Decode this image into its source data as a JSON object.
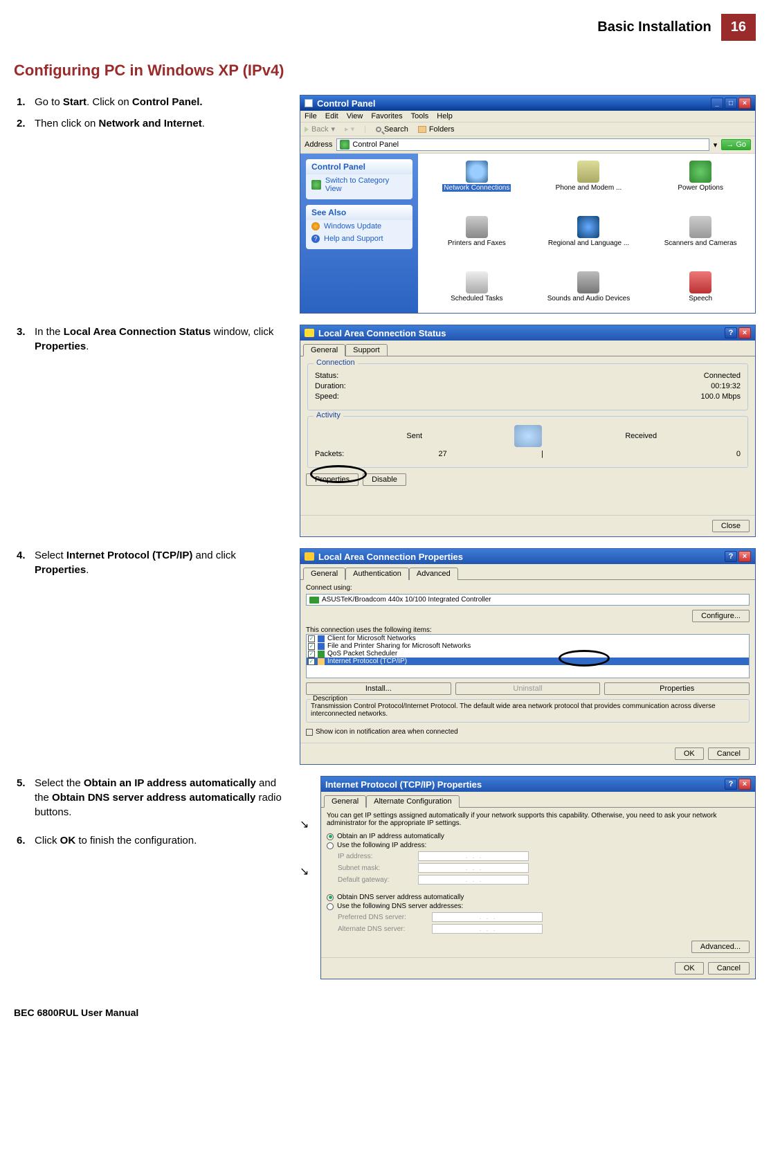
{
  "header": {
    "title": "Basic Installation",
    "page_num": "16"
  },
  "section_title": "Configuring PC in Windows XP (IPv4)",
  "steps": {
    "s1": {
      "num": "1.",
      "pre": "Go to ",
      "b1": "Start",
      "mid": ". Click on ",
      "b2": "Control Panel."
    },
    "s2": {
      "num": "2.",
      "pre": "Then click on ",
      "b1": "Network and Internet",
      "post": "."
    },
    "s3": {
      "num": "3.",
      "pre": "In the ",
      "b1": "Local Area Connection Status",
      "mid": " window, click ",
      "b2": "Properties",
      "post": "."
    },
    "s4": {
      "num": "4.",
      "pre": "Select ",
      "b1": "Internet Protocol (TCP/IP)",
      "mid": " and click ",
      "b2": "Properties",
      "post": "."
    },
    "s5": {
      "num": "5.",
      "pre": "Select the ",
      "b1": "Obtain an IP address automatically",
      "mid": " and the ",
      "b2": "Obtain DNS server address automatically",
      "post": " radio buttons."
    },
    "s6": {
      "num": "6.",
      "pre": "Click ",
      "b1": "OK",
      "post": " to finish the configuration."
    }
  },
  "cp": {
    "title": "Control Panel",
    "menu": {
      "file": "File",
      "edit": "Edit",
      "view": "View",
      "fav": "Favorites",
      "tools": "Tools",
      "help": "Help"
    },
    "tb": {
      "back": "Back",
      "search": "Search",
      "folders": "Folders"
    },
    "addr_label": "Address",
    "addr_value": "Control Panel",
    "go": "Go",
    "side": {
      "panel1_title": "Control Panel",
      "panel1_item": "Switch to Category View",
      "panel2_title": "See Also",
      "panel2_i1": "Windows Update",
      "panel2_i2": "Help and Support"
    },
    "items": {
      "net": "Network Connections",
      "phone": "Phone and Modem ...",
      "power": "Power Options",
      "print": "Printers and Faxes",
      "region": "Regional and Language ...",
      "scan": "Scanners and Cameras",
      "sched": "Scheduled Tasks",
      "sound": "Sounds and Audio Devices",
      "speech": "Speech"
    }
  },
  "lac_status": {
    "title": "Local Area Connection Status",
    "tab1": "General",
    "tab2": "Support",
    "g_conn": "Connection",
    "status_l": "Status:",
    "status_v": "Connected",
    "dur_l": "Duration:",
    "dur_v": "00:19:32",
    "speed_l": "Speed:",
    "speed_v": "100.0 Mbps",
    "g_act": "Activity",
    "sent": "Sent",
    "recv": "Received",
    "pkts": "Packets:",
    "pkts_sent": "27",
    "pkts_recv": "0",
    "btn_prop": "Properties",
    "btn_dis": "Disable",
    "btn_close": "Close"
  },
  "lac_prop": {
    "title": "Local Area Connection Properties",
    "tab1": "General",
    "tab2": "Authentication",
    "tab3": "Advanced",
    "connect_using": "Connect using:",
    "adapter": "ASUSTeK/Broadcom 440x 10/100 Integrated Controller",
    "btn_conf": "Configure...",
    "uses_label": "This connection uses the following items:",
    "items": {
      "i1": "Client for Microsoft Networks",
      "i2": "File and Printer Sharing for Microsoft Networks",
      "i3": "QoS Packet Scheduler",
      "i4": "Internet Protocol (TCP/IP)"
    },
    "btn_install": "Install...",
    "btn_uninstall": "Uninstall",
    "btn_prop": "Properties",
    "desc_t": "Description",
    "desc": "Transmission Control Protocol/Internet Protocol. The default wide area network protocol that provides communication across diverse interconnected networks.",
    "show_icon": "Show icon in notification area when connected",
    "ok": "OK",
    "cancel": "Cancel"
  },
  "tcpip": {
    "title": "Internet Protocol (TCP/IP) Properties",
    "tab1": "General",
    "tab2": "Alternate Configuration",
    "blurb": "You can get IP settings assigned automatically if your network supports this capability. Otherwise, you need to ask your network administrator for the appropriate IP settings.",
    "r1": "Obtain an IP address automatically",
    "r2": "Use the following IP address:",
    "ip": "IP address:",
    "subnet": "Subnet mask:",
    "gw": "Default gateway:",
    "r3": "Obtain DNS server address automatically",
    "r4": "Use the following DNS server addresses:",
    "pdns": "Preferred DNS server:",
    "adns": "Alternate DNS server:",
    "adv": "Advanced...",
    "ok": "OK",
    "cancel": "Cancel"
  },
  "footer": "BEC 6800RUL User Manual"
}
